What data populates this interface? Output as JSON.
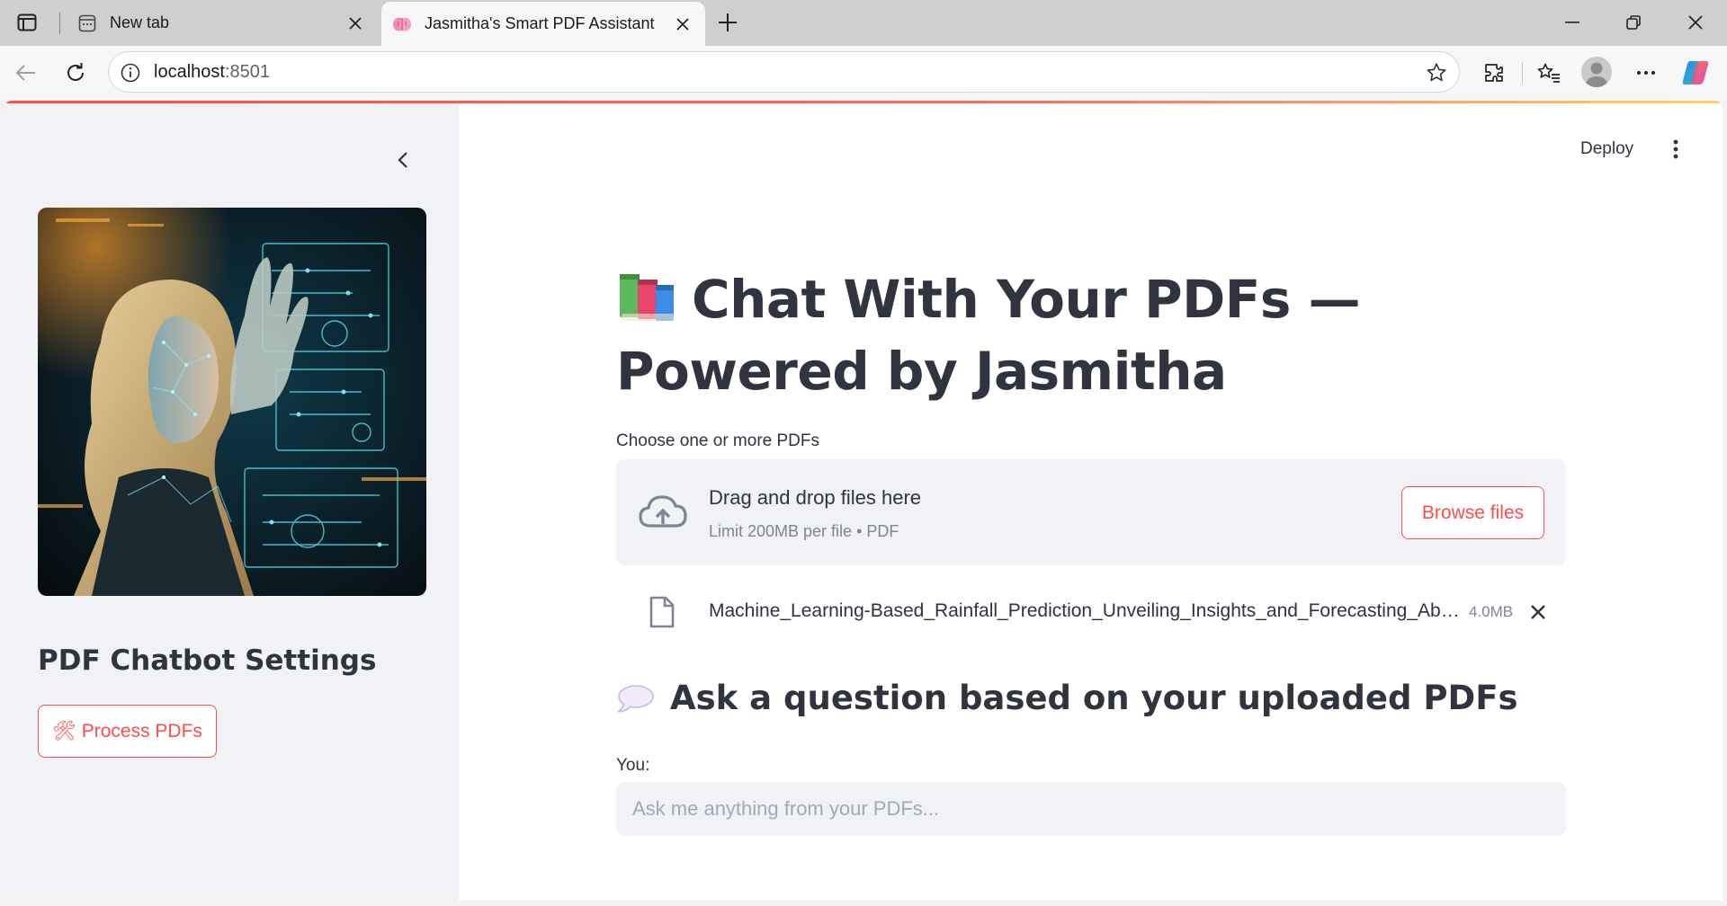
{
  "browser": {
    "tabs": [
      {
        "title": "New tab",
        "active": false
      },
      {
        "title": "Jasmitha's Smart PDF Assistant",
        "active": true
      }
    ],
    "address": {
      "host": "localhost",
      "port": ":8501"
    }
  },
  "colors": {
    "accent": "#ff4b4b",
    "sidebar_bg": "#f0f2f6",
    "text": "#31333f",
    "muted": "#808495"
  },
  "app": {
    "header": {
      "deploy_label": "Deploy"
    },
    "sidebar": {
      "title": "PDF Chatbot Settings",
      "process_button": {
        "icon": "🛠",
        "label": "Process PDFs"
      },
      "image_alt": "woman touching holographic interface"
    },
    "main": {
      "title": "Chat With Your PDFs — Powered by Jasmitha",
      "uploader": {
        "label": "Choose one or more PDFs",
        "drop_text": "Drag and drop files here",
        "limit_text": "Limit 200MB per file • PDF",
        "browse_label": "Browse files",
        "files": [
          {
            "name": "Machine_Learning-Based_Rainfall_Prediction_Unveiling_Insights_and_Forecasting_Abilities_for_Rainfall.pdf",
            "size": "4.0MB"
          }
        ]
      },
      "ask_heading": "Ask a question based on your uploaded PDFs",
      "chat": {
        "label": "You:",
        "placeholder": "Ask me anything from your PDFs...",
        "value": ""
      }
    }
  },
  "icons": [
    "tab-actions-icon",
    "grid-icon",
    "brain-icon",
    "close-icon",
    "plus-icon",
    "minimize-icon",
    "restore-icon",
    "back-icon",
    "refresh-icon",
    "info-icon",
    "star-icon",
    "extensions-icon",
    "favorites-icon",
    "profile-icon",
    "more-icon",
    "copilot-icon",
    "chevron-left-icon",
    "kebab-icon",
    "books-icon",
    "cloud-upload-icon",
    "file-icon",
    "speech-bubble-icon"
  ]
}
